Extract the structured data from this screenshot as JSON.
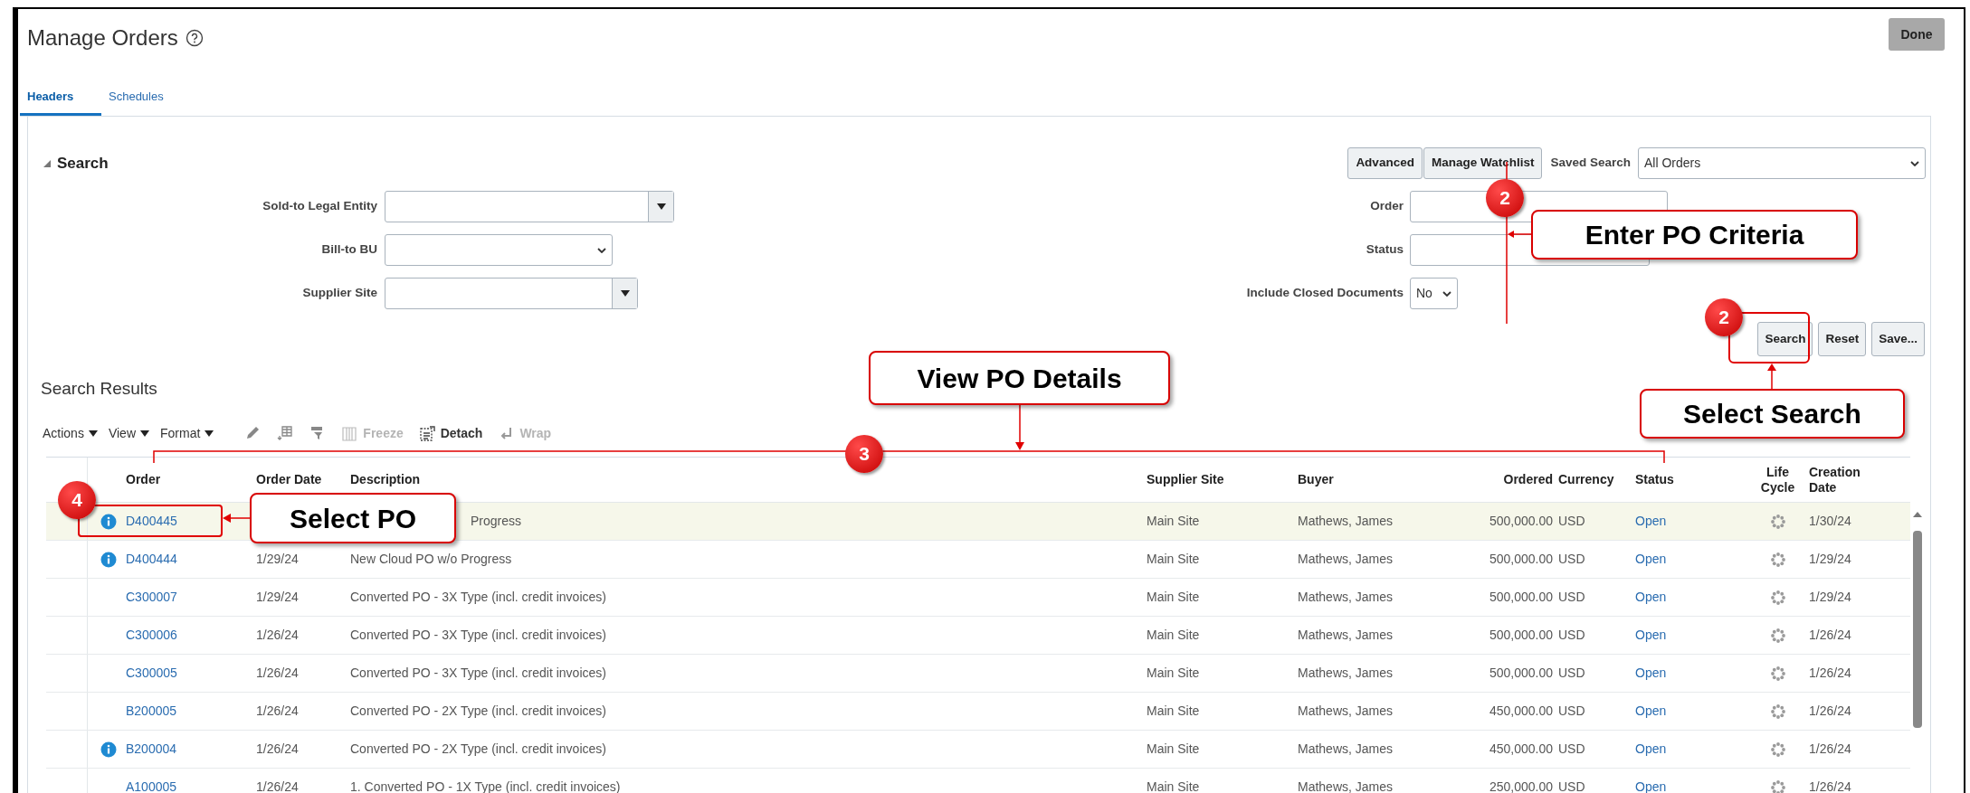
{
  "page": {
    "title": "Manage Orders",
    "done_button": "Done"
  },
  "tabs": [
    {
      "label": "Headers",
      "selected": true
    },
    {
      "label": "Schedules",
      "selected": false
    }
  ],
  "search": {
    "title": "Search",
    "expanded": true,
    "left_fields": [
      {
        "label": "Sold-to Legal Entity",
        "kind": "combo"
      },
      {
        "label": "Bill-to BU",
        "kind": "select"
      },
      {
        "label": "Supplier Site",
        "kind": "combo"
      }
    ],
    "top_buttons": [
      "Advanced",
      "Manage Watchlist"
    ],
    "saved_search": {
      "label": "Saved Search",
      "value": "All Orders"
    },
    "right_fields": [
      {
        "label": "Order",
        "kind": "text"
      },
      {
        "label": "Status",
        "kind": "text"
      },
      {
        "label": "Include Closed Documents",
        "kind": "select",
        "value": "No"
      }
    ],
    "buttons": [
      "Search",
      "Reset",
      "Save..."
    ]
  },
  "results": {
    "title": "Search Results",
    "menus": [
      "Actions",
      "View",
      "Format"
    ],
    "actions": [
      {
        "label": "Freeze",
        "disabled": true
      },
      {
        "label": "Detach",
        "disabled": false
      },
      {
        "label": "Wrap",
        "disabled": true
      }
    ],
    "columns": [
      "Order",
      "Order Date",
      "Description",
      "Supplier Site",
      "Buyer",
      "Ordered",
      "Currency",
      "Status",
      "Life Cycle",
      "Creation Date"
    ],
    "rows": [
      {
        "selected": true,
        "info": true,
        "covered": true,
        "order": "D400445",
        "description": "Progress",
        "supplier_site": "Main Site",
        "buyer": "Mathews, James",
        "ordered": "500,000.00",
        "currency": "USD",
        "status": "Open",
        "creation_date": "1/30/24"
      },
      {
        "selected": false,
        "info": true,
        "covered": false,
        "order": "D400444",
        "order_date": "1/29/24",
        "description": "New Cloud PO w/o Progress",
        "supplier_site": "Main Site",
        "buyer": "Mathews, James",
        "ordered": "500,000.00",
        "currency": "USD",
        "status": "Open",
        "creation_date": "1/29/24"
      },
      {
        "selected": false,
        "info": false,
        "covered": false,
        "order": "C300007",
        "order_date": "1/29/24",
        "description": "Converted PO - 3X Type (incl. credit invoices)",
        "supplier_site": "Main Site",
        "buyer": "Mathews, James",
        "ordered": "500,000.00",
        "currency": "USD",
        "status": "Open",
        "creation_date": "1/29/24"
      },
      {
        "selected": false,
        "info": false,
        "covered": false,
        "order": "C300006",
        "order_date": "1/26/24",
        "description": "Converted PO - 3X Type (incl. credit invoices)",
        "supplier_site": "Main Site",
        "buyer": "Mathews, James",
        "ordered": "500,000.00",
        "currency": "USD",
        "status": "Open",
        "creation_date": "1/26/24"
      },
      {
        "selected": false,
        "info": false,
        "covered": false,
        "order": "C300005",
        "order_date": "1/26/24",
        "description": "Converted PO - 3X Type (incl. credit invoices)",
        "supplier_site": "Main Site",
        "buyer": "Mathews, James",
        "ordered": "500,000.00",
        "currency": "USD",
        "status": "Open",
        "creation_date": "1/26/24"
      },
      {
        "selected": false,
        "info": false,
        "covered": false,
        "order": "B200005",
        "order_date": "1/26/24",
        "description": "Converted PO - 2X Type (incl. credit invoices)",
        "supplier_site": "Main Site",
        "buyer": "Mathews, James",
        "ordered": "450,000.00",
        "currency": "USD",
        "status": "Open",
        "creation_date": "1/26/24"
      },
      {
        "selected": false,
        "info": true,
        "covered": false,
        "order": "B200004",
        "order_date": "1/26/24",
        "description": "Converted PO - 2X Type (incl. credit invoices)",
        "supplier_site": "Main Site",
        "buyer": "Mathews, James",
        "ordered": "450,000.00",
        "currency": "USD",
        "status": "Open",
        "creation_date": "1/26/24"
      },
      {
        "selected": false,
        "info": false,
        "covered": false,
        "order": "A100005",
        "order_date": "1/26/24",
        "description": "1. Converted PO - 1X Type (incl. credit invoices)",
        "supplier_site": "Main Site",
        "buyer": "Mathews, James",
        "ordered": "250,000.00",
        "currency": "USD",
        "status": "Open",
        "creation_date": "1/26/24"
      }
    ]
  },
  "annotations": [
    {
      "badge": "2",
      "label": "Enter PO Criteria"
    },
    {
      "badge": "2",
      "label": "Select Search"
    },
    {
      "badge": "3",
      "label": "View PO Details"
    },
    {
      "badge": "4",
      "label": "Select PO"
    }
  ]
}
